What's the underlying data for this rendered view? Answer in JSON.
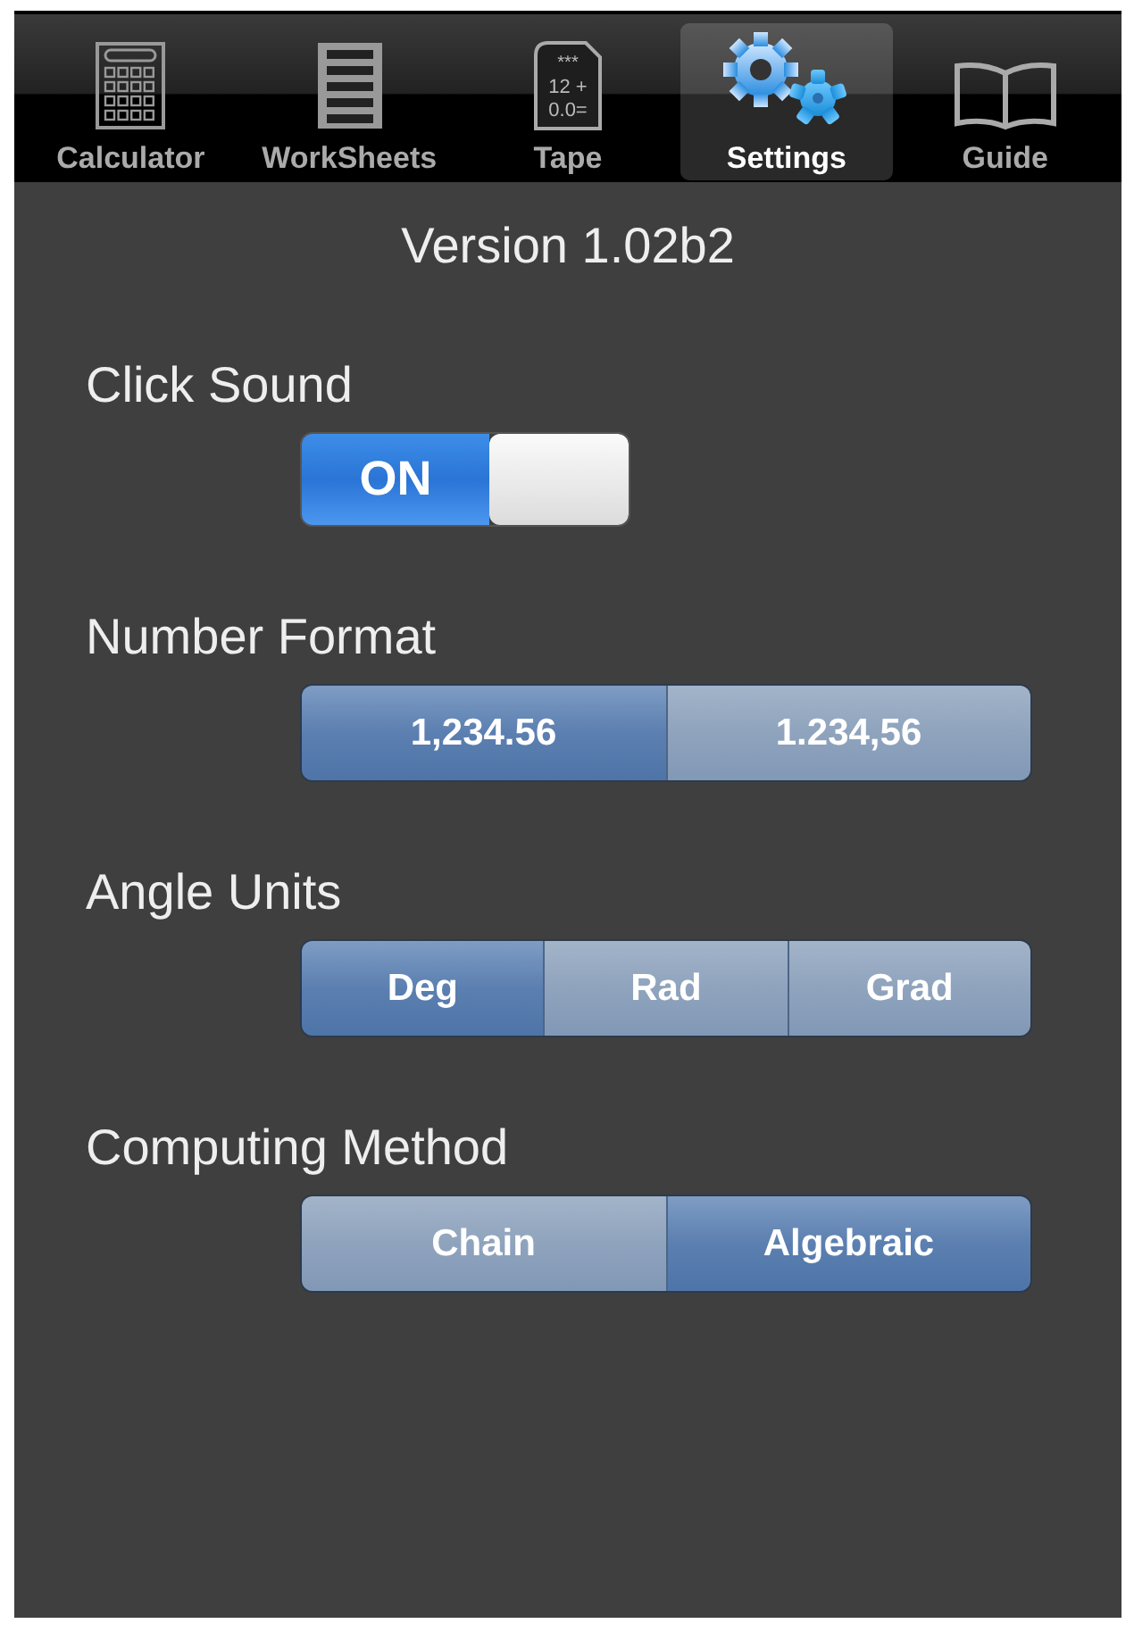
{
  "tab_bar": [
    {
      "kind": "calculator",
      "label": "Calculator",
      "selected": false
    },
    {
      "kind": "list",
      "label": "WorkSheets",
      "selected": false
    },
    {
      "kind": "tape",
      "label": "Tape",
      "selected": false,
      "icon_lines": [
        "***",
        "12 +",
        "0.0="
      ]
    },
    {
      "kind": "gears",
      "label": "Settings",
      "selected": true
    },
    {
      "kind": "book",
      "label": "Guide",
      "selected": false
    }
  ],
  "version": "Version 1.02b2",
  "settings": [
    {
      "kind": "toggle",
      "label": "Click Sound",
      "on": true,
      "state_label": "ON"
    },
    {
      "kind": "segments",
      "label": "Number Format",
      "options": [
        {
          "label": "1,234.56",
          "selected": true
        },
        {
          "label": "1.234,56",
          "selected": false
        }
      ]
    },
    {
      "kind": "segments",
      "label": "Angle Units",
      "options": [
        {
          "label": "Deg",
          "selected": true
        },
        {
          "label": "Rad",
          "selected": false
        },
        {
          "label": "Grad",
          "selected": false
        }
      ]
    },
    {
      "kind": "segments",
      "label": "Computing Method",
      "options": [
        {
          "label": "Chain",
          "selected": false
        },
        {
          "label": "Algebraic",
          "selected": true
        }
      ]
    }
  ]
}
